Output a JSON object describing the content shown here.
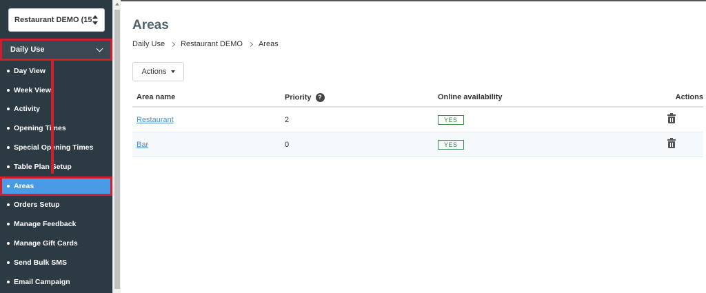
{
  "sidebar": {
    "venue_select": "Restaurant DEMO (15...",
    "section": "Daily Use",
    "items": [
      {
        "label": "Day View"
      },
      {
        "label": "Week View"
      },
      {
        "label": "Activity"
      },
      {
        "label": "Opening Times"
      },
      {
        "label": "Special Opening Times"
      },
      {
        "label": "Table Plan Setup"
      },
      {
        "label": "Areas",
        "active": true
      },
      {
        "label": "Orders Setup"
      },
      {
        "label": "Manage Feedback"
      },
      {
        "label": "Manage Gift Cards"
      },
      {
        "label": "Send Bulk SMS"
      },
      {
        "label": "Email Campaign"
      }
    ]
  },
  "main": {
    "title": "Areas",
    "breadcrumb": [
      "Daily Use",
      "Restaurant DEMO",
      "Areas"
    ],
    "actions_label": "Actions",
    "table": {
      "headers": {
        "area_name": "Area name",
        "priority": "Priority",
        "online": "Online availability",
        "actions": "Actions"
      },
      "rows": [
        {
          "name": "Restaurant",
          "priority": "2",
          "online": "YES"
        },
        {
          "name": "Bar",
          "priority": "0",
          "online": "YES"
        }
      ]
    }
  },
  "colors": {
    "sidebar_bg": "#2c3a44",
    "active_item": "#4a9be6",
    "highlight_red": "#d0202e",
    "badge_green": "#3a8a47",
    "link_blue": "#4a8fcf"
  },
  "icons": {
    "help": "question-circle-icon",
    "delete": "trash-icon",
    "dropdown": "caret-down-icon"
  }
}
